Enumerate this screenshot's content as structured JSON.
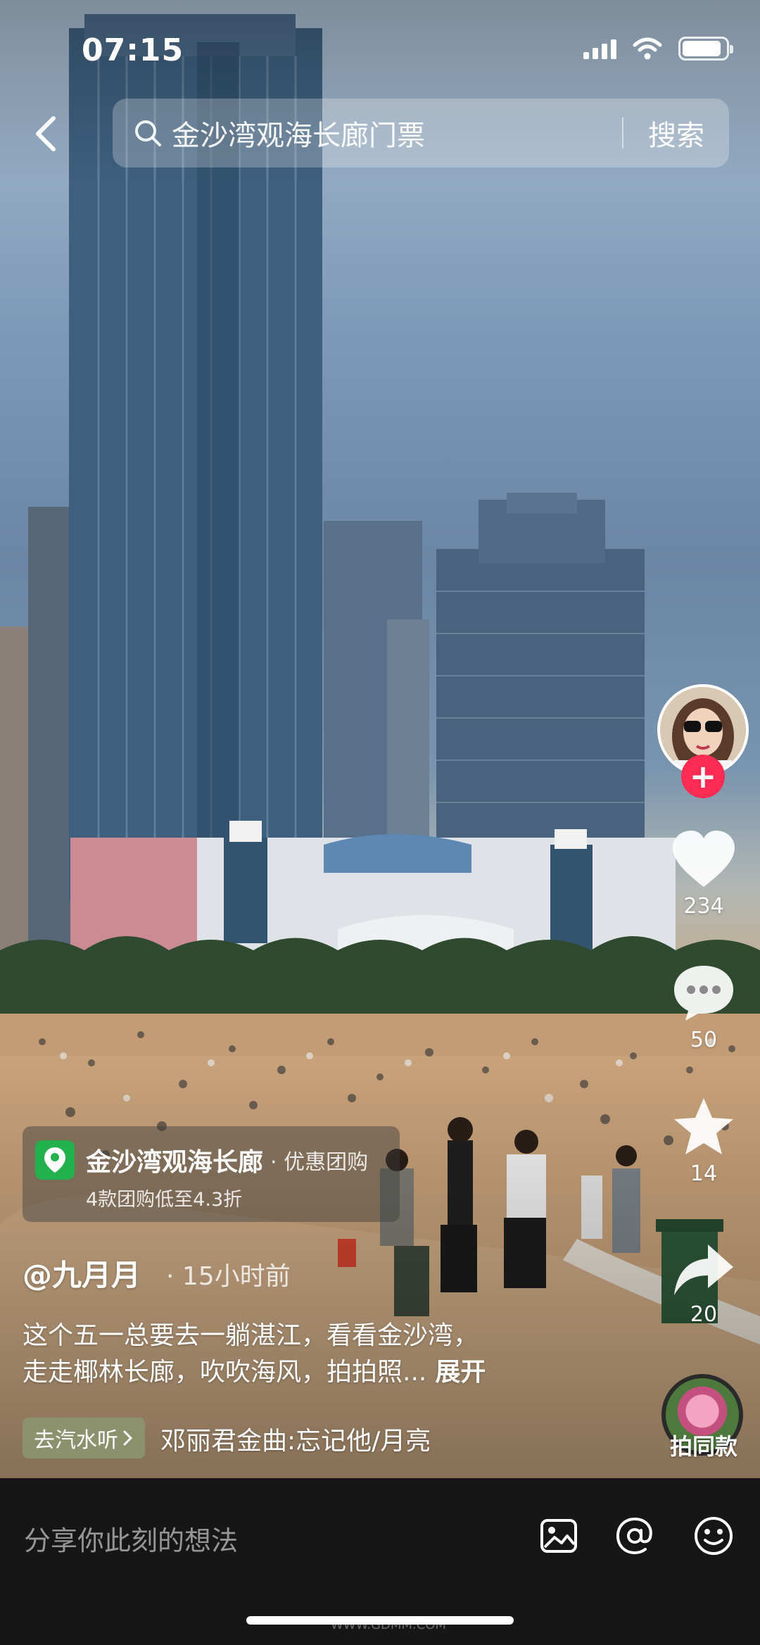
{
  "status_bar": {
    "time": "07:15",
    "battery_level": 0.9
  },
  "search": {
    "query": "金沙湾观海长廊门票",
    "button": "搜索"
  },
  "actions": {
    "likes": "234",
    "comments": "50",
    "favorites": "14",
    "shares": "20",
    "follow_symbol": "+",
    "music_label": "拍同款"
  },
  "location": {
    "name": "金沙湾观海长廊",
    "tag": "· 优惠团购",
    "subtitle": "4款团购低至4.3折"
  },
  "post": {
    "author": "@九月月",
    "time": "· 15小时前",
    "caption_line1": "这个五一总要去一躺湛江，看看金沙湾，",
    "caption_line2": "走走椰林长廊，吹吹海风，拍拍照...",
    "expand": "展开"
  },
  "music": {
    "chip": "去汽水听",
    "song": "邓丽君金曲:忘记他/月亮"
  },
  "comment_bar": {
    "placeholder": "分享你此刻的想法"
  },
  "watermark": "WWW.GDMM.COM",
  "icons": [
    "back-icon",
    "search-icon",
    "heart-icon",
    "comment-icon",
    "star-icon",
    "share-icon",
    "image-icon",
    "at-icon",
    "emoji-icon",
    "location-pin-icon",
    "wifi-icon",
    "signal-icon",
    "battery-icon"
  ],
  "colors": {
    "accent": "#fe2c55",
    "location_pin": "#22b14c",
    "bottom_bar": "#161616"
  }
}
